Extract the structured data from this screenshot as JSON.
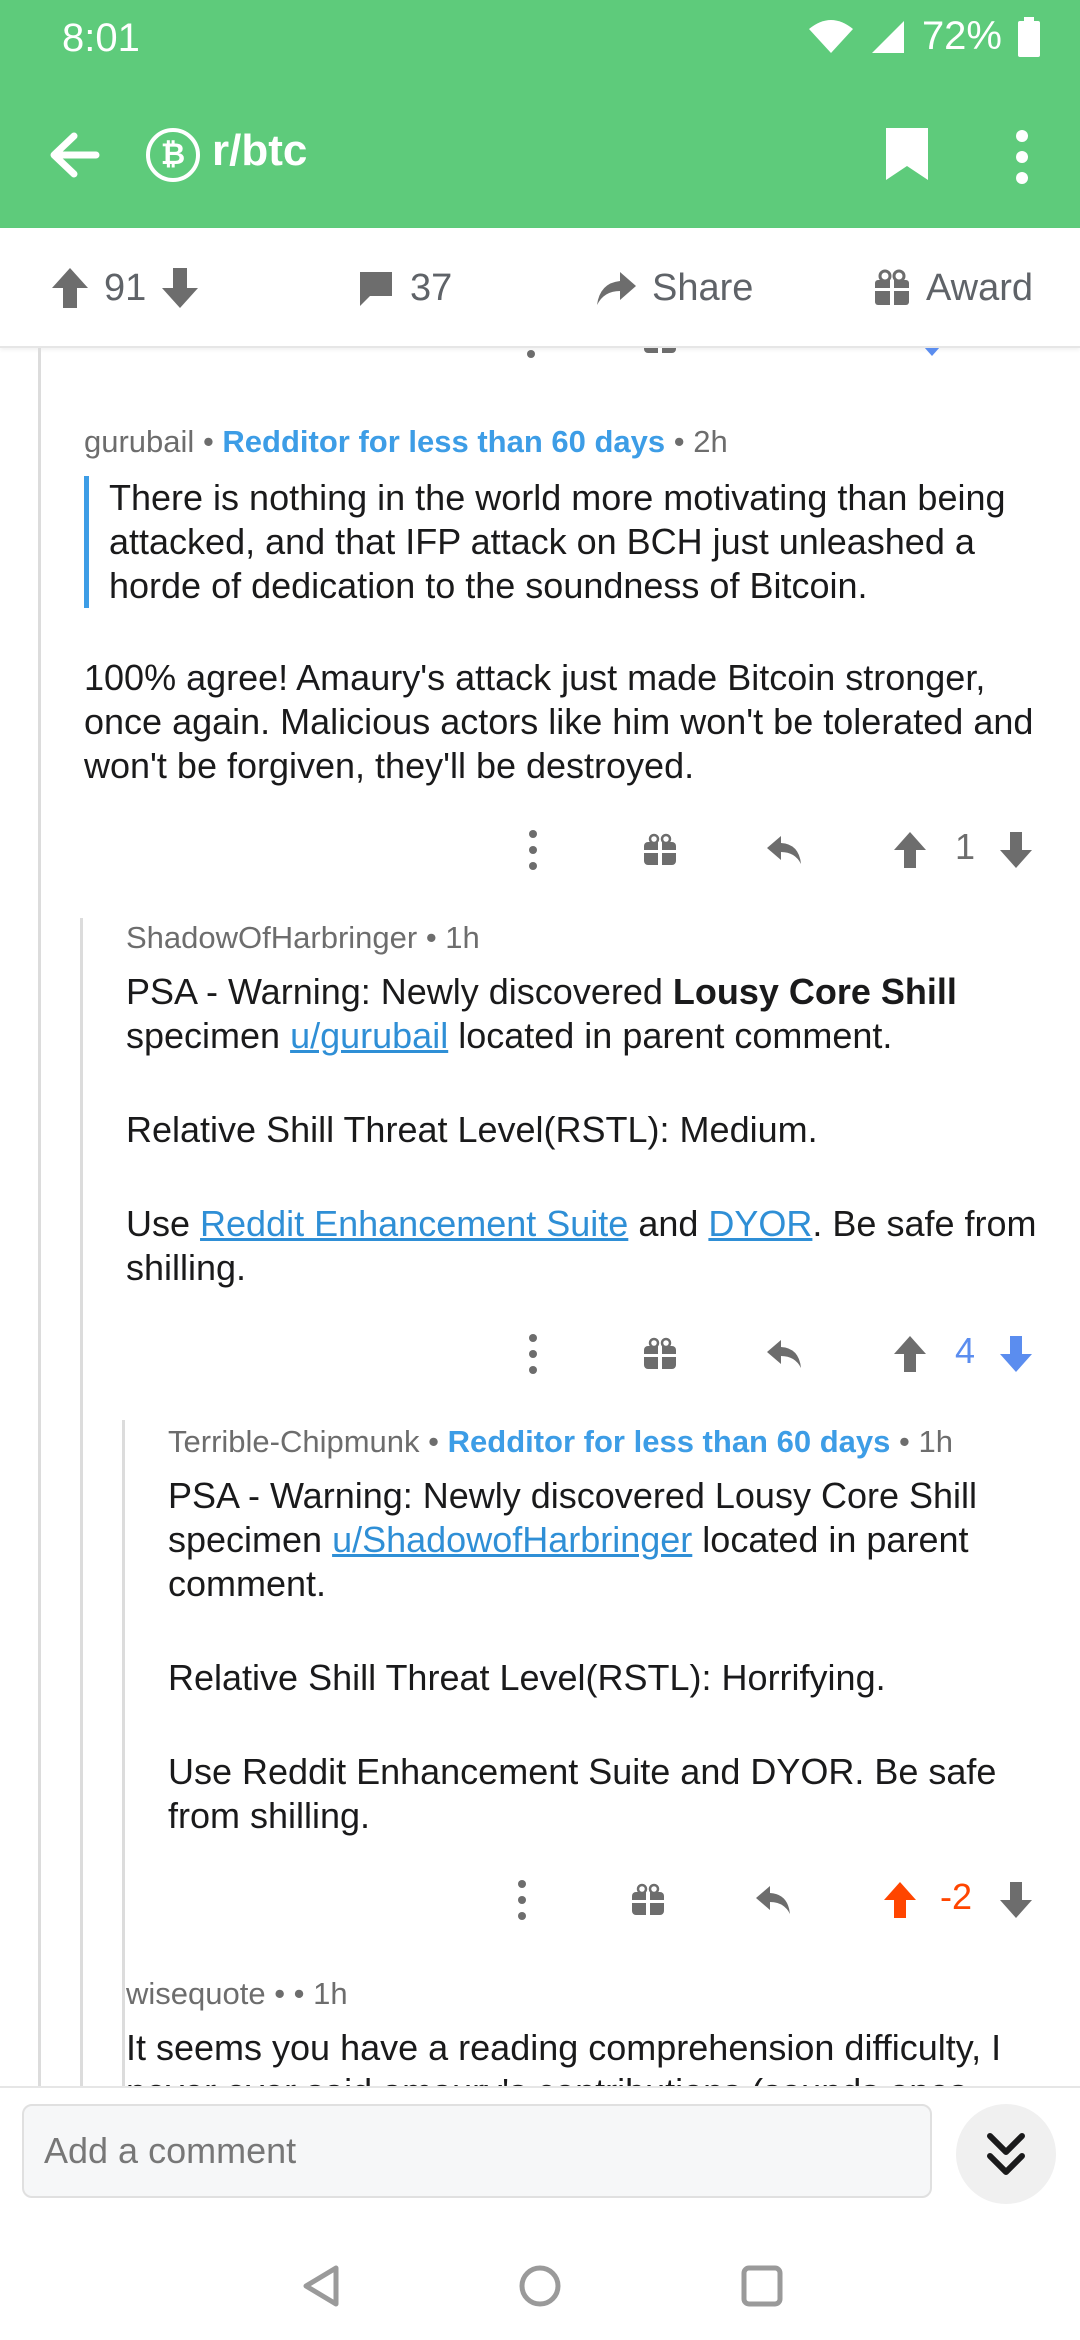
{
  "status": {
    "time": "8:01",
    "battery": "72%"
  },
  "header": {
    "subreddit": "r/btc",
    "sub_icon_glyph": "₿"
  },
  "action_bar": {
    "score": "91",
    "comments": "37",
    "share_label": "Share",
    "award_label": "Award"
  },
  "comments": [
    {
      "author": "gurubail",
      "flair": "Redditor for less than 60 days",
      "time": "2h",
      "quote": "There is nothing in the world more motivating than being attacked, and that IFP attack on BCH just unleashed a horde of dedication to the soundness of Bitcoin.",
      "text": "100% agree! Amaury's attack just made Bitcoin stronger, once again. Malicious actors like him won't be tolerated and won't be forgiven, they'll be destroyed.",
      "score": "1"
    },
    {
      "author": "ShadowOfHarbringer",
      "time": "1h",
      "p1_a": "PSA - Warning: Newly discovered ",
      "p1_bold": "Lousy Core Shill",
      "p1_b": " specimen ",
      "p1_link": "u/gurubail",
      "p1_c": " located in parent comment.",
      "p2": "Relative Shill Threat Level(RSTL): Medium.",
      "p3_a": "Use ",
      "p3_link1": "Reddit Enhancement Suite",
      "p3_b": " and ",
      "p3_link2": "DYOR",
      "p3_c": ". Be safe from shilling.",
      "score": "4"
    },
    {
      "author": "Terrible-Chipmunk",
      "flair": "Redditor for less than 60 days",
      "time": "1h",
      "p1_a": "PSA - Warning: Newly discovered Lousy Core Shill specimen ",
      "p1_link": "u/ShadowofHarbringer",
      "p1_b": " located in parent comment.",
      "p2": "Relative Shill Threat Level(RSTL): Horrifying.",
      "p3": "Use Reddit Enhancement Suite and DYOR. Be safe from shilling.",
      "score": "-2"
    },
    {
      "author": "wisequote",
      "time": "1h",
      "text": "It seems you have a reading comprehension difficulty, I never ever said amaury's contributions (sounds ones"
    }
  ],
  "comment_bar": {
    "placeholder": "Add a comment"
  },
  "colors": {
    "header": "#5ecb7b",
    "flair": "#3d9de6",
    "upvote": "#ff4500",
    "downvote": "#5b8def"
  }
}
